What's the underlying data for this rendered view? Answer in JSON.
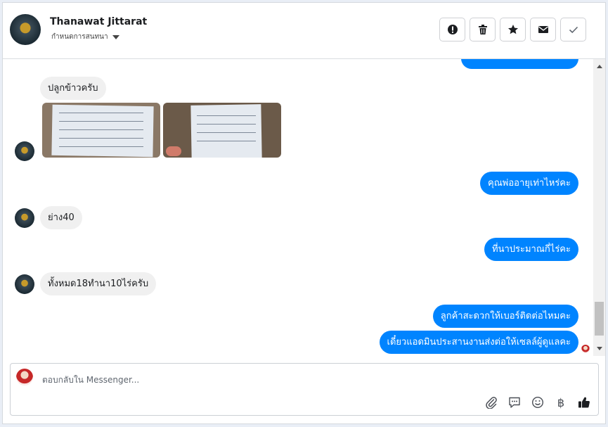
{
  "header": {
    "name": "Thanawat Jittarat",
    "subtitle": "กำหนดการสนทนา",
    "actions": [
      "alert-icon",
      "trash-icon",
      "star-icon",
      "envelope-icon",
      "check-icon"
    ]
  },
  "messages": {
    "in_1": "ปลูกข้าวครับ",
    "out_1": "คุณพ่ออายุเท่าไหร่คะ",
    "in_2": "ย่าง40",
    "out_2": "ที่นาประมาณกี่ไร่คะ",
    "in_3": "ทั้งหมด18ทำนา10ไร่ครับ",
    "out_3": "ลูกค้าสะดวกให้เบอร์ติดต่อไหมคะ",
    "out_4": "เดี๋ยวแอดมินประสานงานส่งต่อให้เซลล์ผู้ดูแลคะ"
  },
  "composer": {
    "placeholder": "ตอบกลับใน Messenger...",
    "tools": [
      "attach-icon",
      "saved-replies-icon",
      "emoji-icon",
      "baht-icon",
      "thumbs-up-icon"
    ],
    "baht_glyph": "฿"
  },
  "colors": {
    "accent": "#0084ff",
    "incoming": "#f0f0f0"
  }
}
